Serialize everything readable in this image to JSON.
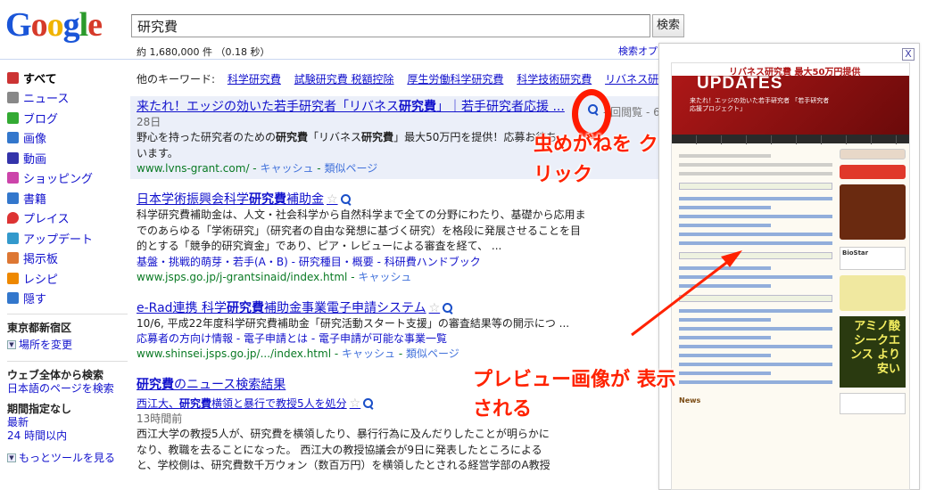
{
  "logo_text": "Google",
  "search": {
    "query": "研究費",
    "button_label": "検索"
  },
  "result_stats": "約 1,680,000 件 （0.18 秒）",
  "search_options_label": "検索オプ",
  "sidebar": {
    "items": [
      {
        "label": "すべて",
        "icon": "all-icon",
        "color": "#c33",
        "active": true
      },
      {
        "label": "ニュース",
        "icon": "news-icon",
        "color": "#888"
      },
      {
        "label": "ブログ",
        "icon": "blog-icon",
        "color": "#3a3"
      },
      {
        "label": "画像",
        "icon": "image-icon",
        "color": "#37c"
      },
      {
        "label": "動画",
        "icon": "video-icon",
        "color": "#33a"
      },
      {
        "label": "ショッピング",
        "icon": "shopping-icon",
        "color": "#c4a"
      },
      {
        "label": "書籍",
        "icon": "book-icon",
        "color": "#37c"
      },
      {
        "label": "プレイス",
        "icon": "place-icon",
        "color": "#d33"
      },
      {
        "label": "アップデート",
        "icon": "update-icon",
        "color": "#39c"
      },
      {
        "label": "掲示板",
        "icon": "forum-icon",
        "color": "#d73"
      },
      {
        "label": "レシピ",
        "icon": "recipe-icon",
        "color": "#e80"
      },
      {
        "label": "隠す",
        "icon": "hide-icon",
        "color": "#37c"
      }
    ],
    "location": "東京都新宿区",
    "change_location": "場所を変更",
    "web_scope_title": "ウェブ全体から検索",
    "japanese_pages": "日本語のページを検索",
    "period_title": "期間指定なし",
    "period_latest": "最新",
    "period_24h": "24 時間以内",
    "more_tools": "もっとツールを見る"
  },
  "related": {
    "label": "他のキーワード:",
    "keywords": [
      "科学研究費",
      "試験研究費 税額控除",
      "厚生労働科学研究費",
      "科学技術研究費",
      "リバネス研究費"
    ]
  },
  "results": [
    {
      "title_a": "来たれ！エッジの効いた若手研究者「リバネス",
      "title_b": "研究費",
      "title_c": "」｜若手研究者応援 ...",
      "extra": "- 回閲覧 - 6",
      "date": "28日",
      "snippet_a": "野心を持った研究者のための",
      "snippet_b": "研究費",
      "snippet_c": "「リバネス",
      "snippet_d": "研究費",
      "snippet_e": "」最大50万円を提供！応募お待ち",
      "snippet_line2": "います。",
      "url": "www.lvns-grant.com/",
      "cache": "キャッシュ",
      "similar": "類似ページ"
    },
    {
      "title_a": "日本学術振興会科学",
      "title_b": "研究費",
      "title_c": "補助金",
      "snippet_lines": [
        "科学研究費補助金は、人文・社会科学から自然科学まで全ての分野にわたり、基礎から応用ま",
        "でのあらゆる「学術研究」（研究者の自由な発想に基づく研究）を格段に発展させることを目",
        "的とする「競争的研究資金」であり、ピア・レビューによる審査を経て、 ..."
      ],
      "sub_links": [
        "基盤・挑戦的萌芽・若手(A・B)",
        "研究種目・概要",
        "科研費ハンドブック"
      ],
      "url": "www.jsps.go.jp/j-grantsinaid/index.html",
      "cache": "キャッシュ"
    },
    {
      "title_a": "e-Rad連携 科学",
      "title_b": "研究費",
      "title_c": "補助金事業電子申請システム",
      "snippet_lines": [
        "10/6, 平成22年度科学研究費補助金「研究活動スタート支援」の審査結果等の開示につ ..."
      ],
      "sub_links": [
        "応募者の方向け情報",
        "電子申請とは",
        "電子申請が可能な事業一覧"
      ],
      "url": "www.shinsei.jsps.go.jp/.../index.html",
      "cache": "キャッシュ",
      "similar": "類似ページ"
    },
    {
      "title_a": "研究費",
      "title_c": " のニュース検索結果",
      "news_title_a": "西江大、",
      "news_title_b": "研究費",
      "news_title_c": "横領と暴行で教授5人を処分",
      "news_time": "13時間前",
      "snippet_lines": [
        "西江大学の教授5人が、研究費を横領したり、暴行行為に及んだりしたことが明らかに",
        "なり、教職を去ることになった。 西江大の教授協議会が9日に発表したところによる",
        "と、学校側は、研究費数千万ウォン（数百万円）を横領したとされる経営学部のA教授"
      ]
    }
  ],
  "preview": {
    "close_label": "X",
    "banner_title": "リバネス研究費 最大50万円提供",
    "updates": "UPDATES",
    "tagline": "来たれ！エッジの効いた若手研究者 「若手研究者応援プロジェクト」",
    "news_label": "News",
    "ad_text": "アミノ酸 シークエンス より安い",
    "bio_text": "BioStar"
  },
  "annotations": {
    "note1": "虫めがねを クリック",
    "note2": "プレビュー画像が 表示される",
    "color": "#ff2200"
  }
}
